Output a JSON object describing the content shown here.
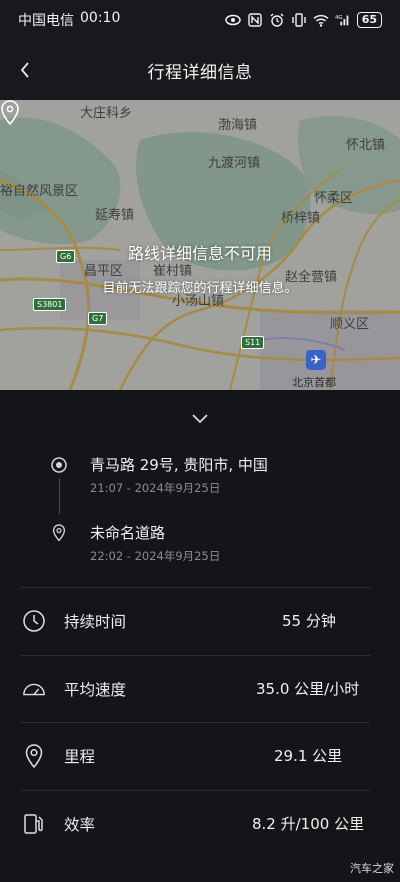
{
  "status_bar": {
    "carrier": "中国电信",
    "time": "00:10",
    "icons": [
      "eye-icon",
      "nfc-icon",
      "alarm-icon",
      "vibrate-icon",
      "wifi-icon",
      "signal-icon"
    ],
    "signal_text": "4G",
    "battery": "65"
  },
  "header": {
    "title": "行程详细信息",
    "back_icon": "chevron-left-icon"
  },
  "map": {
    "unavailable_title": "路线详细信息不可用",
    "unavailable_subtitle": "目前无法跟踪您的行程详细信息。",
    "labels": {
      "l1": "大庄科乡",
      "l2": "渤海镇",
      "l3": "怀北镇",
      "l4": "九渡河镇",
      "l5": "怀柔区",
      "l6": "延寿镇",
      "l7": "桥梓镇",
      "l8": "昌平区",
      "l9": "崔村镇",
      "l10": "赵全营镇",
      "l11": "小汤山镇",
      "l12": "顺义区",
      "l13": "北京首都",
      "l14": "裕自然风景区"
    },
    "roads": {
      "g6": "G6",
      "g7": "G7",
      "s3801": "S3801",
      "s11": "S11"
    }
  },
  "trip": {
    "start": {
      "name": "青马路 29号, 贵阳市, 中国",
      "time": "21:07 - 2024年9月25日"
    },
    "end": {
      "name": "未命名道路",
      "time": "22:02 - 2024年9月25日"
    }
  },
  "stats": [
    {
      "icon": "clock-icon",
      "label": "持续时间",
      "value": "55 分钟"
    },
    {
      "icon": "speedometer-icon",
      "label": "平均速度",
      "value": "35.0 公里/小时"
    },
    {
      "icon": "location-pin-icon",
      "label": "里程",
      "value": "29.1 公里"
    },
    {
      "icon": "fuel-pump-icon",
      "label": "效率",
      "value": "8.2 升/100 公里"
    }
  ],
  "watermark": "汽车之家",
  "colors": {
    "background": "#141518",
    "header": "#18191c",
    "divider": "#2c2d31",
    "muted_text": "#8a8b90"
  }
}
